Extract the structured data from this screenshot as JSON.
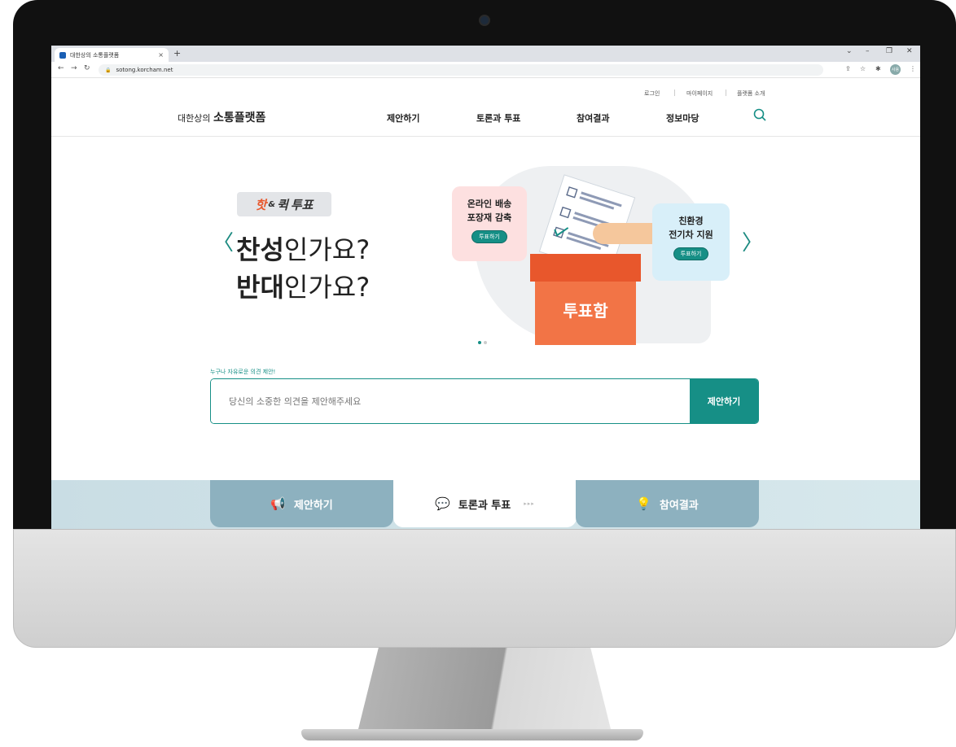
{
  "browser": {
    "tab_title": "대한상의 소통플랫폼",
    "tab_close": "×",
    "new_tab": "+",
    "url": "sotong.korcham.net",
    "profile": "사용"
  },
  "utility_links": [
    "로그인",
    "마이페이지",
    "플랫폼 소개"
  ],
  "logo": {
    "prefix": "대한상의",
    "name": "소통플랫폼"
  },
  "nav": [
    "제안하기",
    "토론과 투표",
    "참여결과",
    "정보마당"
  ],
  "hero": {
    "badge": {
      "part1": "핫",
      "amp": "&",
      "part2": "퀵",
      "part3": "투표"
    },
    "headline_line1_bold": "찬성",
    "headline_line1_rest": "인가요?",
    "headline_line2_bold": "반대",
    "headline_line2_rest": "인가요?",
    "prev_arrow": "〈",
    "next_arrow": "〉",
    "card_left": {
      "line1": "온라인 배송",
      "line2": "포장재 감축",
      "button": "투표하기"
    },
    "card_right": {
      "line1": "친환경",
      "line2": "전기차 지원",
      "button": "투표하기"
    },
    "ballot_box": "투표함",
    "slides_total": 2,
    "slide_active": 1
  },
  "proposal": {
    "label": "누구나 자유로운 의견 제안!",
    "placeholder": "당신의 소중한 의견을 제안해주세요",
    "button": "제안하기"
  },
  "bottom_tabs": [
    {
      "label": "제안하기",
      "icon": "megaphone-icon",
      "active": false
    },
    {
      "label": "토론과 투표",
      "icon": "chat-bubble-icon",
      "active": true,
      "more": "▸▸▸"
    },
    {
      "label": "참여결과",
      "icon": "lightbulb-icon",
      "active": false
    }
  ],
  "colors": {
    "accent": "#168f86",
    "box": "#f27446",
    "tab_inactive": "#8db1bf"
  }
}
